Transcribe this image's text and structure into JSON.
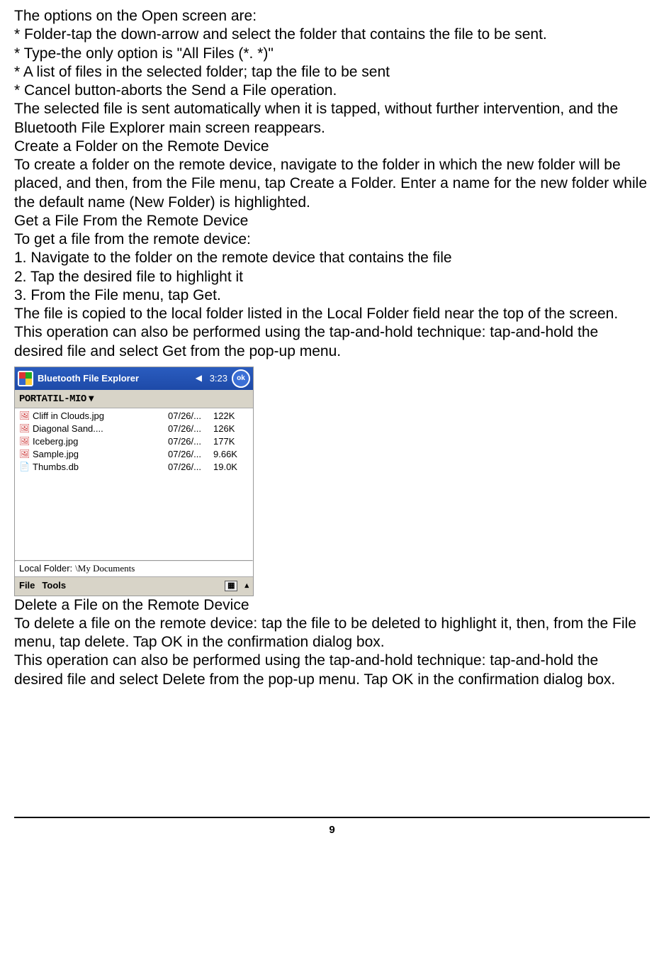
{
  "body": {
    "l1": "The options on the Open screen are:",
    "l2": "* Folder-tap the down-arrow and select the folder that contains the file to be sent.",
    "l3": "* Type-the only option is \"All Files (*. *)\"",
    "l4": "* A list of files in the selected folder; tap the file to be sent",
    "l5": "* Cancel button-aborts the Send a File operation.",
    "l6": "The selected file is sent automatically when it is tapped, without further intervention, and the Bluetooth File Explorer main screen reappears.",
    "l7": "Create a Folder on the Remote Device",
    "l8": "To create a folder on the remote device, navigate to the folder in which the new folder will be placed, and then, from the File menu, tap Create a Folder. Enter a name for the new folder while the default name (New Folder) is highlighted.",
    "l9": "Get a File From the Remote Device",
    "l10": "To get a file from the remote device:",
    "l11": "1. Navigate to the folder on the remote device that contains the file",
    "l12": "2. Tap the desired file to highlight it",
    "l13": "3. From the File menu, tap Get.",
    "l14": "The file is copied to the local folder listed in the Local Folder field near the top of the screen. This operation can also be performed using the tap-and-hold technique: tap-and-hold the desired file and select Get from the pop-up menu.",
    "l15": "Delete a File on the Remote Device",
    "l16": "To delete a file on the remote device: tap the file to be deleted to highlight it, then, from the File menu, tap delete. Tap OK in the confirmation dialog box.",
    "l17": "This operation can also be performed using the tap-and-hold technique: tap-and-hold the desired file and select Delete from the pop-up menu. Tap OK in the confirmation dialog box."
  },
  "screenshot": {
    "title": "Bluetooth File Explorer",
    "time": "3:23",
    "ok": "ok",
    "breadcrumb": "PORTATIL-MIO",
    "files": [
      {
        "name": "Cliff in Clouds.jpg",
        "date": "07/26/...",
        "size": "122K",
        "icon": "img"
      },
      {
        "name": "Diagonal Sand....",
        "date": "07/26/...",
        "size": "126K",
        "icon": "img"
      },
      {
        "name": "Iceberg.jpg",
        "date": "07/26/...",
        "size": "177K",
        "icon": "img"
      },
      {
        "name": "Sample.jpg",
        "date": "07/26/...",
        "size": "9.66K",
        "icon": "img"
      },
      {
        "name": "Thumbs.db",
        "date": "07/26/...",
        "size": "19.0K",
        "icon": "db"
      }
    ],
    "localFolderLabel": "Local Folder:",
    "localFolderValue": "\\My Documents",
    "menuFile": "File",
    "menuTools": "Tools",
    "kbd": "▦",
    "arrow": "▴"
  },
  "pageNumber": "9"
}
